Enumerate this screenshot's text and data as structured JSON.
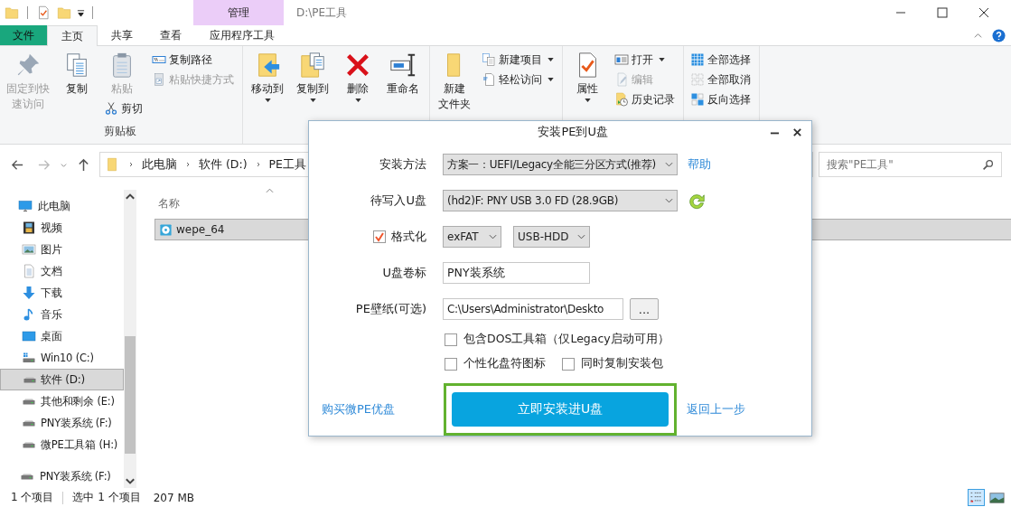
{
  "window": {
    "title": "D:\\PE工具",
    "context_tab": "管理"
  },
  "tabs": [
    {
      "label": "文件",
      "kind": "file",
      "selected": false
    },
    {
      "label": "主页",
      "kind": "tab",
      "selected": true
    },
    {
      "label": "共享",
      "kind": "tab",
      "selected": false
    },
    {
      "label": "查看",
      "kind": "tab",
      "selected": false
    },
    {
      "label": "应用程序工具",
      "kind": "context",
      "selected": false
    }
  ],
  "ribbon": {
    "groups": [
      {
        "label": "剪贴板",
        "columns": [
          [
            {
              "lines": [
                "固定到快",
                "速访问"
              ],
              "kind": "large",
              "disabled": true,
              "dropdown": false
            }
          ],
          [
            {
              "label": "复制",
              "kind": "large",
              "disabled": false,
              "dropdown": false
            }
          ],
          [
            {
              "label": "粘贴",
              "kind": "large",
              "disabled": true,
              "dropdown": false
            },
            {
              "label": "剪切",
              "kind": "small",
              "disabled": false,
              "dropdown": false
            }
          ],
          [
            {
              "label": "复制路径",
              "kind": "small",
              "disabled": false,
              "dropdown": false
            },
            {
              "label": "粘贴快捷方式",
              "kind": "small",
              "disabled": true,
              "dropdown": false
            }
          ]
        ]
      },
      {
        "columns": [
          [
            {
              "label": "移动到",
              "kind": "large",
              "disabled": false,
              "dropdown": true
            }
          ],
          [
            {
              "label": "复制到",
              "kind": "large",
              "disabled": false,
              "dropdown": true
            }
          ],
          [
            {
              "label": "删除",
              "kind": "large",
              "disabled": false,
              "dropdown": true
            }
          ],
          [
            {
              "label": "重命名",
              "kind": "large",
              "disabled": false,
              "dropdown": false
            }
          ]
        ]
      },
      {
        "columns": [
          [
            {
              "lines": [
                "新建",
                "文件夹"
              ],
              "kind": "large",
              "disabled": false,
              "dropdown": false
            }
          ],
          [
            {
              "label": "新建项目",
              "kind": "small",
              "disabled": false,
              "dropdown": true
            },
            {
              "label": "轻松访问",
              "kind": "small",
              "disabled": false,
              "dropdown": true
            }
          ]
        ]
      },
      {
        "columns": [
          [
            {
              "label": "属性",
              "kind": "large",
              "disabled": false,
              "dropdown": true
            }
          ],
          [
            {
              "label": "打开",
              "kind": "small",
              "disabled": false,
              "dropdown": true
            },
            {
              "label": "编辑",
              "kind": "small",
              "disabled": true,
              "dropdown": false
            },
            {
              "label": "历史记录",
              "kind": "small",
              "disabled": false,
              "dropdown": false
            }
          ]
        ]
      },
      {
        "columns": [
          [
            {
              "label": "全部选择",
              "kind": "small",
              "disabled": false,
              "dropdown": false
            },
            {
              "label": "全部取消",
              "kind": "small",
              "disabled": false,
              "dropdown": false
            },
            {
              "label": "反向选择",
              "kind": "small",
              "disabled": false,
              "dropdown": false
            }
          ]
        ]
      }
    ]
  },
  "address": {
    "segments": [
      "此电脑",
      "软件 (D:)",
      "PE工具"
    ]
  },
  "search": {
    "placeholder": "搜索\"PE工具\""
  },
  "nav": [
    {
      "label": "此电脑",
      "selected": false,
      "children": [
        {
          "label": "视频",
          "selected": false
        },
        {
          "label": "图片",
          "selected": false
        },
        {
          "label": "文档",
          "selected": false
        },
        {
          "label": "下载",
          "selected": false
        },
        {
          "label": "音乐",
          "selected": false
        },
        {
          "label": "桌面",
          "selected": false
        },
        {
          "label": "Win10 (C:)",
          "selected": false
        },
        {
          "label": "软件 (D:)",
          "selected": true
        },
        {
          "label": "其他和剩余 (E:)",
          "selected": false
        },
        {
          "label": "PNY装系统 (F:)",
          "selected": false
        },
        {
          "label": "微PE工具箱 (H:)",
          "selected": false
        }
      ]
    },
    {
      "label": "PNY装系统 (F:)",
      "selected": false
    }
  ],
  "files": {
    "column": "名称",
    "rows": [
      {
        "name": "wepe_64",
        "selected": true
      }
    ]
  },
  "status_bar": {
    "count": "1 个项目",
    "selection": "选中 1 个项目",
    "size": "207 MB",
    "views": [
      {
        "kind": "details",
        "selected": true
      },
      {
        "kind": "large_icons",
        "selected": false
      }
    ]
  },
  "dialog": {
    "title": "安装PE到U盘",
    "rows": [
      {
        "kind": "select",
        "label": "安装方法",
        "value": "方案一：UEFI/Legacy全能三分区方式(推荐)",
        "action": {
          "kind": "link",
          "label": "帮助"
        }
      },
      {
        "kind": "select",
        "label": "待写入U盘",
        "value": "(hd2)F: PNY USB 3.0 FD (28.9GB)",
        "action": {
          "kind": "refresh"
        }
      },
      {
        "kind": "format",
        "label": "格式化",
        "checked": true,
        "selects": [
          "exFAT",
          "USB-HDD"
        ]
      },
      {
        "kind": "input",
        "label": "U盘卷标",
        "value": "PNY装系统"
      },
      {
        "kind": "browse",
        "label": "PE壁纸(可选)",
        "value": "C:\\Users\\Administrator\\Deskto",
        "button": "..."
      }
    ],
    "options": [
      [
        {
          "label": "包含DOS工具箱（仅Legacy启动可用）",
          "checked": false
        }
      ],
      [
        {
          "label": "个性化盘符图标",
          "checked": false
        },
        {
          "label": "同时复制安装包",
          "checked": false
        }
      ]
    ],
    "footer": {
      "left_link": "购买微PE优盘",
      "primary": "立即安装进U盘",
      "highlighted": true,
      "right_link": "返回上一步"
    }
  }
}
